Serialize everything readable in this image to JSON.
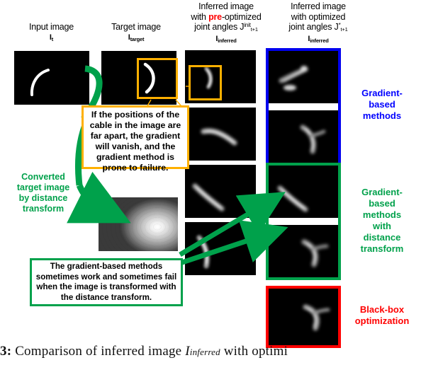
{
  "figure": {
    "caption_number": "3:",
    "caption_text": "Comparison of inferred image",
    "caption_math": "I",
    "caption_math_sub": "inferred",
    "caption_tail": "with optimi"
  },
  "columns": [
    {
      "name": "input-image",
      "line1": "Input image",
      "symbol": "I",
      "symbol_sub": "t"
    },
    {
      "name": "target-image",
      "line1": "Target image",
      "symbol": "I",
      "symbol_sub": "target"
    },
    {
      "name": "inferred-pre-optimized",
      "line1": "Inferred image",
      "line2_a": "with ",
      "line2_red": "pre",
      "line2_b": "-optimized",
      "line3": "joint angles J",
      "line3_sup": "init",
      "line3_sub": "t+1",
      "symbol": "I",
      "symbol_sub": "inferred"
    },
    {
      "name": "inferred-optimized",
      "line1": "Inferred image",
      "line2": "with optimized",
      "line3": "joint angles J",
      "line3_sup": "*",
      "line3_sub": "t+1",
      "symbol": "I",
      "symbol_sub": "inferred"
    }
  ],
  "callouts": {
    "orange": {
      "lines": [
        "If the positions of the",
        "cable in the image are",
        "far apart, the gradient",
        "will vanish, and the",
        "gradient method is",
        "prone to failure."
      ],
      "border_color": "#ffb000"
    },
    "green": {
      "lines": [
        "The gradient-based methods",
        "sometimes work and sometimes fail",
        "when the image is transformed with",
        "the distance transform."
      ],
      "border_color": "#00a14b"
    }
  },
  "annotations": {
    "converted": {
      "lines": [
        "Converted",
        "target image",
        "by distance",
        "transform"
      ],
      "color": "#00a14b"
    }
  },
  "side_labels": [
    {
      "name": "gradient-based-methods",
      "lines": [
        "Gradient-",
        "based",
        "methods"
      ],
      "color": "#0000ff"
    },
    {
      "name": "gradient-based-methods-with-distance-transform",
      "lines": [
        "Gradient-",
        "based",
        "methods",
        "with",
        "distance",
        "transform"
      ],
      "color": "#00a14b"
    },
    {
      "name": "black-box-optimization",
      "lines": [
        "Black-box",
        "optimization"
      ],
      "color": "#ff0000"
    }
  ],
  "colors": {
    "blue": "#0000ee",
    "green": "#00a14b",
    "red": "#ff0000",
    "orange": "#ffb000",
    "panel_bg": "#000000",
    "cable": "#ffffff"
  }
}
